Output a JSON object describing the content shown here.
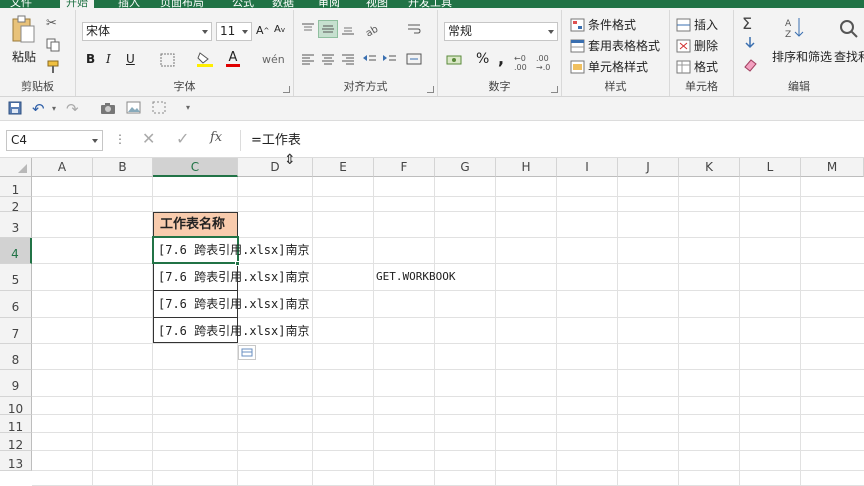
{
  "ribbon": {
    "tabs": [
      "文件",
      "开始",
      "插入",
      "页面布局",
      "公式",
      "数据",
      "审阅",
      "视图",
      "开发工具"
    ],
    "clipboard": {
      "paste": "粘贴",
      "label": "剪贴板"
    },
    "font": {
      "name": "宋体",
      "size": "11",
      "bold": "B",
      "italic": "I",
      "underline": "U",
      "label": "字体"
    },
    "alignment": {
      "label": "对齐方式"
    },
    "number": {
      "format": "常规",
      "percent": "%",
      "comma": ",",
      "label": "数字"
    },
    "styles": {
      "conditional": "条件格式",
      "table": "套用表格格式",
      "cell_styles": "单元格样式",
      "label": "样式"
    },
    "cells": {
      "insert": "插入",
      "delete": "删除",
      "format": "格式",
      "label": "单元格"
    },
    "editing": {
      "sort": "排序和筛选",
      "find": "查找和",
      "label": "编辑"
    }
  },
  "formula_bar": {
    "name_box": "C4",
    "fx": "fx",
    "formula": "=工作表"
  },
  "columns": [
    "A",
    "B",
    "C",
    "D",
    "E",
    "F",
    "G",
    "H",
    "I",
    "J",
    "K",
    "L",
    "M"
  ],
  "rows": [
    "1",
    "2",
    "3",
    "4",
    "5",
    "6",
    "7",
    "8",
    "9",
    "10",
    "11",
    "12",
    "13"
  ],
  "cells": {
    "C3": "工作表名称",
    "C4": "[7.6 跨表引用.xlsx]南京",
    "C5": "[7.6 跨表引用.xlsx]南京",
    "C6": "[7.6 跨表引用.xlsx]南京",
    "C7": "[7.6 跨表引用.xlsx]南京",
    "F5": "GET.WORKBOOK"
  },
  "colors": {
    "accent": "#217346",
    "header_fill": "#f8cbad"
  }
}
